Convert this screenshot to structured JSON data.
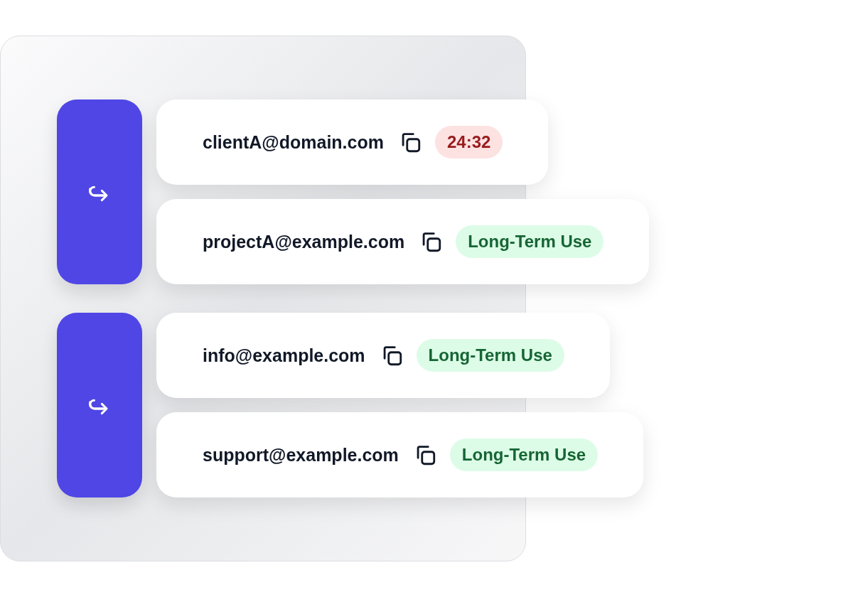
{
  "groups": [
    {
      "rows": [
        {
          "email": "clientA@domain.com",
          "badge": {
            "kind": "timer",
            "text": "24:32"
          }
        },
        {
          "email": "projectA@example.com",
          "badge": {
            "kind": "tag",
            "text": "Long-Term Use"
          }
        }
      ]
    },
    {
      "rows": [
        {
          "email": "info@example.com",
          "badge": {
            "kind": "tag",
            "text": "Long-Term Use"
          }
        },
        {
          "email": "support@example.com",
          "badge": {
            "kind": "tag",
            "text": "Long-Term Use"
          }
        }
      ]
    }
  ]
}
